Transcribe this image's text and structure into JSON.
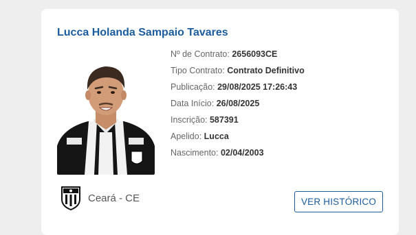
{
  "player": {
    "name": "Lucca Holanda Sampaio Tavares",
    "photo_icon": "player-photo",
    "fields": [
      {
        "label": "Nº de Contrato:",
        "value": "2656093CE"
      },
      {
        "label": "Tipo Contrato:",
        "value": "Contrato Definitivo"
      },
      {
        "label": "Publicação:",
        "value": "29/08/2025 17:26:43"
      },
      {
        "label": "Data Início:",
        "value": "26/08/2025"
      },
      {
        "label": "Inscrição:",
        "value": "587391"
      },
      {
        "label": "Apelido:",
        "value": "Lucca"
      },
      {
        "label": "Nascimento:",
        "value": "02/04/2003"
      }
    ]
  },
  "club": {
    "name": "Ceará - CE",
    "badge_icon": "ceara-crest-icon"
  },
  "actions": {
    "history_label": "VER HISTÓRICO"
  },
  "colors": {
    "accent": "#1a5c9e",
    "background": "#eeeeee",
    "card": "#ffffff"
  }
}
